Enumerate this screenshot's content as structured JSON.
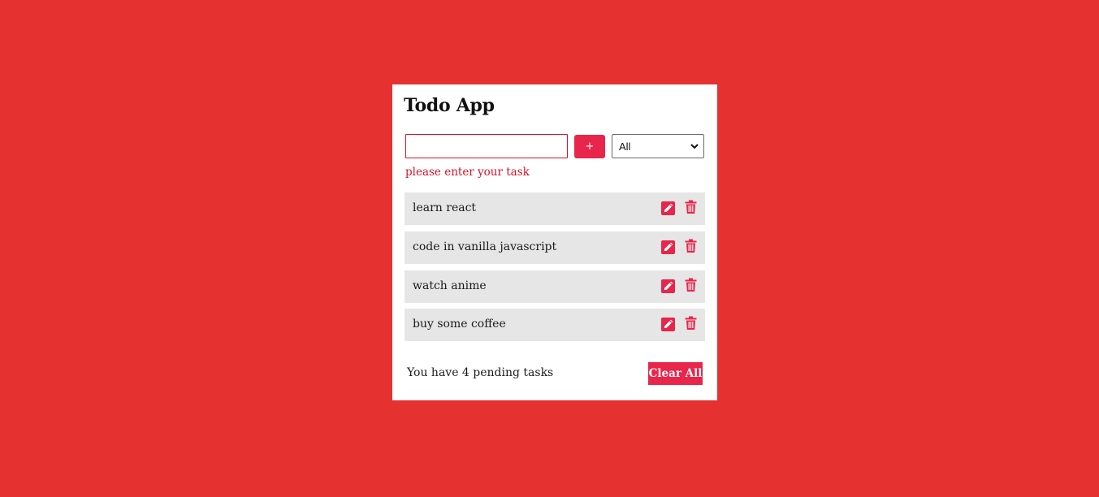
{
  "app": {
    "title": "Todo App"
  },
  "form": {
    "input_value": "",
    "input_placeholder": "",
    "add_label": "+",
    "filter_selected": "All",
    "error_message": "please enter your task"
  },
  "tasks": [
    {
      "text": "learn react"
    },
    {
      "text": "code in vanilla javascript"
    },
    {
      "text": "watch anime"
    },
    {
      "text": "buy some coffee"
    }
  ],
  "footer": {
    "pending_text": "You have 4 pending tasks",
    "clear_label": "Clear All"
  },
  "colors": {
    "background": "#e63131",
    "accent": "#e8254a",
    "error": "#d0142c",
    "task_bg": "#e6e6e6"
  },
  "icons": {
    "edit": "pencil-icon",
    "delete": "trash-icon",
    "select": "chevron-down-icon"
  }
}
